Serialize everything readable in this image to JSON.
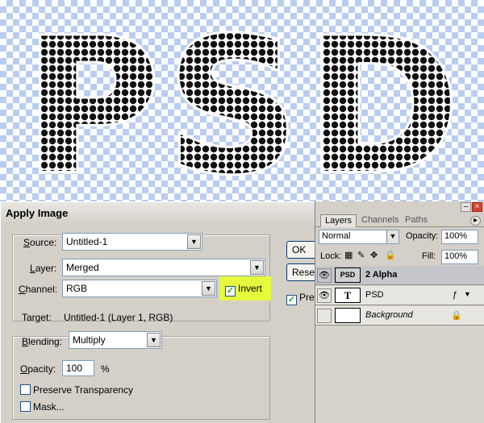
{
  "canvas": {
    "art_text": "PSD",
    "text_color": "#111111"
  },
  "dialog": {
    "title": "Apply Image",
    "source_label": "Source:",
    "source_value": "Untitled-1",
    "layer_label": "Layer:",
    "layer_value": "Merged",
    "channel_label": "Channel:",
    "channel_value": "RGB",
    "invert_label": "Invert",
    "invert_checked": true,
    "target_label": "Target:",
    "target_value": "Untitled-1 (Layer 1, RGB)",
    "blending_label": "Blending:",
    "blending_value": "Multiply",
    "opacity_label": "Opacity:",
    "opacity_value": "100",
    "opacity_unit": "%",
    "preserve_transparency_label": "Preserve Transparency",
    "mask_label": "Mask...",
    "ok_label": "OK",
    "reset_label": "Reset",
    "preview_label": "Preview",
    "highlight_color": "#e6fa3c"
  },
  "layers_panel": {
    "tabs": [
      "Layers",
      "Channels",
      "Paths"
    ],
    "blend_mode": "Normal",
    "opacity_label": "Opacity:",
    "opacity_value": "100%",
    "lock_label": "Lock:",
    "fill_label": "Fill:",
    "fill_value": "100%",
    "layers": [
      {
        "name": "2 Alpha",
        "thumb": "PSD",
        "selected": true,
        "visible": true
      },
      {
        "name": "PSD",
        "thumb": "T",
        "selected": false,
        "visible": true
      },
      {
        "name": "Background",
        "thumb": "",
        "selected": false,
        "visible": false,
        "locked": true
      }
    ]
  }
}
